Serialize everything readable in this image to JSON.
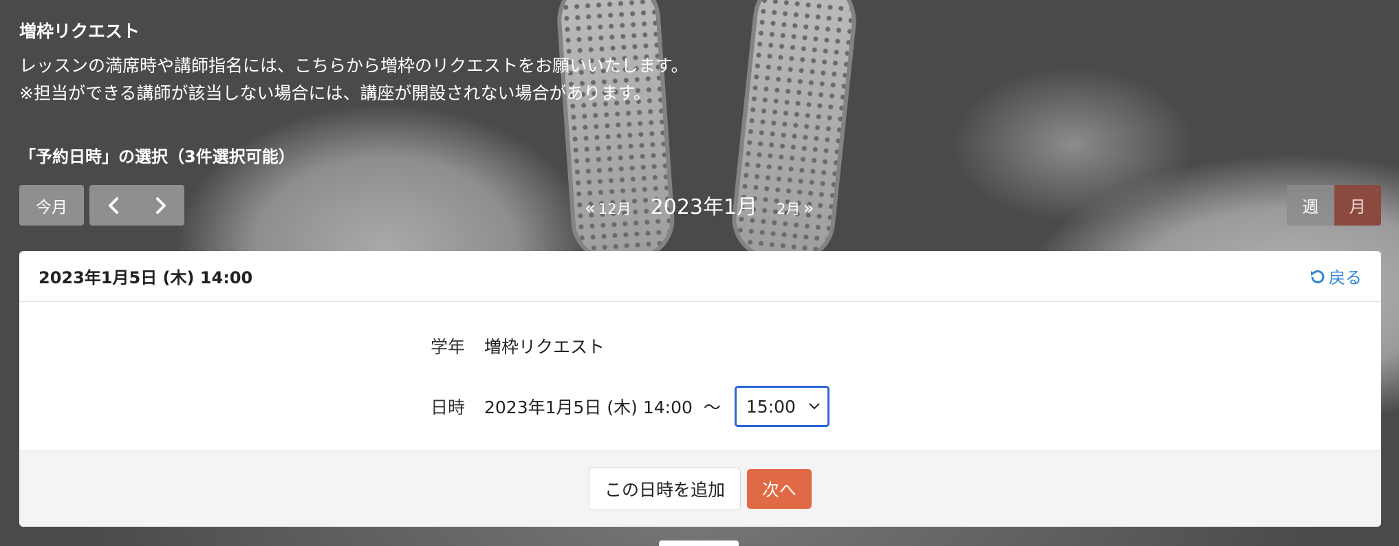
{
  "intro": {
    "title": "増枠リクエスト",
    "line1": "レッスンの満席時や講師指名には、こちらから増枠のリクエストをお願いいたします。",
    "line2": "※担当ができる講師が該当しない場合には、講座が開設されない場合があります。"
  },
  "section_label": "「予約日時」の選択（3件選択可能）",
  "toolbar": {
    "today_label": "今月",
    "prev_month_label": "12月",
    "current_month": "2023年1月",
    "next_month_label": "2月",
    "view_week": "週",
    "view_month": "月"
  },
  "panel": {
    "header_date": "2023年1月5日 (木) 14:00",
    "back_label": "戻る",
    "grade_label": "学年",
    "grade_value": "増枠リクエスト",
    "datetime_label": "日時",
    "datetime_start": "2023年1月5日 (木) 14:00",
    "range_separator": "～",
    "end_time_selected": "15:00",
    "add_button": "この日時を追加",
    "next_button": "次へ"
  },
  "colors": {
    "accent": "#e06a45",
    "link": "#2f86d6",
    "month_toggle_active": "#8b4a3f",
    "select_border": "#2a64d6"
  }
}
